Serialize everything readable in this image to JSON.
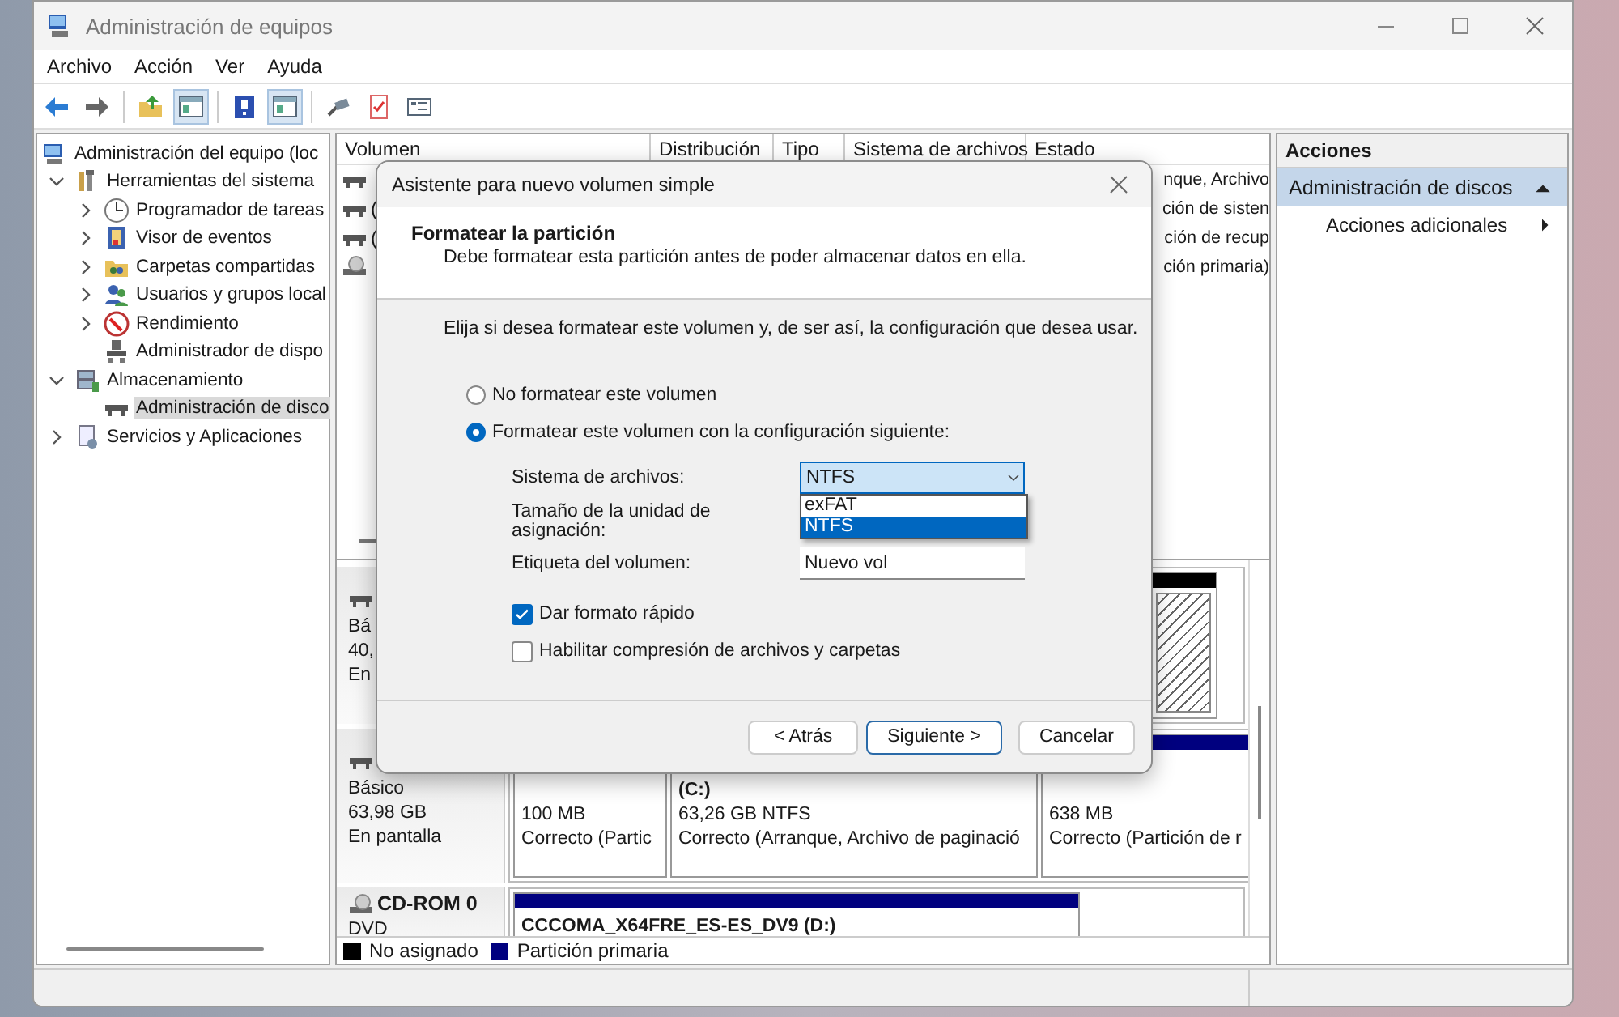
{
  "window": {
    "title": "Administración de equipos"
  },
  "menu": [
    "Archivo",
    "Acción",
    "Ver",
    "Ayuda"
  ],
  "toolbar": [
    {
      "pressed": false
    },
    {
      "pressed": false
    },
    {
      "pressed": false
    },
    {
      "pressed": true
    },
    {
      "pressed": false
    },
    {
      "pressed": true
    },
    {
      "pressed": false
    },
    {
      "pressed": false
    },
    {
      "pressed": false
    }
  ],
  "tree": [
    {
      "label": "Administración del equipo (loc",
      "selected": false,
      "children": [
        {
          "label": "Herramientas del sistema",
          "expanded": true,
          "selected": false,
          "children": [
            {
              "label": "Programador de tareas",
              "expanded": false,
              "selected": false
            },
            {
              "label": "Visor de eventos",
              "expanded": false,
              "selected": false
            },
            {
              "label": "Carpetas compartidas",
              "expanded": false,
              "selected": false
            },
            {
              "label": "Usuarios y grupos local",
              "expanded": false,
              "selected": false
            },
            {
              "label": "Rendimiento",
              "expanded": false,
              "selected": false
            },
            {
              "label": "Administrador de dispo",
              "selected": false
            }
          ]
        },
        {
          "label": "Almacenamiento",
          "expanded": true,
          "selected": false,
          "children": [
            {
              "label": "Administración de disco",
              "selected": true
            }
          ]
        },
        {
          "label": "Servicios y Aplicaciones",
          "expanded": false,
          "selected": false
        }
      ]
    }
  ],
  "volume_table": {
    "columns": [
      "Volumen",
      "Distribución",
      "Tipo",
      "Sistema de archivos",
      "Estado"
    ],
    "rows": [
      {
        "kind": "disk",
        "estado": "nque, Archivo"
      },
      {
        "kind": "disk",
        "volume": "(",
        "estado": "ción de sisten"
      },
      {
        "kind": "disk",
        "volume": "(",
        "estado": "ción de recup"
      },
      {
        "kind": "cd",
        "estado": "ción primaria)"
      }
    ]
  },
  "disks": [
    {
      "kind": "disk",
      "lines": [
        "Bá",
        "40,",
        "En"
      ],
      "partitions": [
        {
          "kind": "unallocated"
        }
      ]
    },
    {
      "kind": "disk",
      "lines": [
        "Básico",
        "63,98 GB",
        "En pantalla"
      ],
      "partitions": [
        {
          "kind": "primary",
          "lines": [
            "100 MB",
            "Correcto (Partic"
          ]
        },
        {
          "kind": "primary",
          "title": "(C:)",
          "lines": [
            "63,26 GB NTFS",
            "Correcto (Arranque, Archivo de paginació"
          ]
        },
        {
          "kind": "primary",
          "lines": [
            "638 MB",
            "Correcto (Partición de r"
          ]
        }
      ]
    },
    {
      "kind": "cd",
      "name": "CD-ROM 0",
      "lines": [
        "DVD"
      ],
      "partitions": [
        {
          "kind": "primary",
          "title": "CCCOMA_X64FRE_ES-ES_DV9 (D:)"
        }
      ]
    }
  ],
  "legend": [
    {
      "label": "No asignado",
      "color": "#000000"
    },
    {
      "label": "Partición primaria",
      "color": "#00007f"
    }
  ],
  "actions": {
    "title": "Acciones",
    "items": [
      {
        "label": "Administración de discos",
        "kind": "section"
      },
      {
        "label": "Acciones adicionales",
        "kind": "submenu"
      }
    ]
  },
  "dialog": {
    "title": "Asistente para nuevo volumen simple",
    "heading": "Formatear la partición",
    "subheading": "Debe formatear esta partición antes de poder almacenar datos en ella.",
    "instruction": "Elija si desea formatear este volumen y, de ser así, la configuración que desea usar.",
    "options": [
      {
        "label": "No formatear este volumen",
        "selected": false
      },
      {
        "label": "Formatear este volumen con la configuración siguiente:",
        "selected": true
      }
    ],
    "fields": [
      {
        "label": "Sistema de archivos:",
        "kind": "combo",
        "value": "NTFS",
        "dropdown": [
          {
            "label": "exFAT",
            "selected": false
          },
          {
            "label": "NTFS",
            "selected": true
          }
        ]
      },
      {
        "label": "Tamaño de la unidad de asignación:",
        "kind": "covered"
      },
      {
        "label": "Etiqueta del volumen:",
        "kind": "text",
        "value": "Nuevo vol"
      }
    ],
    "checkboxes": [
      {
        "label": "Dar formato rápido",
        "checked": true
      },
      {
        "label": "Habilitar compresión de archivos y carpetas",
        "checked": false
      }
    ],
    "buttons": [
      {
        "label": "< Atrás",
        "default": false
      },
      {
        "label": "Siguiente >",
        "default": true
      },
      {
        "label": "Cancelar",
        "default": false
      }
    ]
  }
}
